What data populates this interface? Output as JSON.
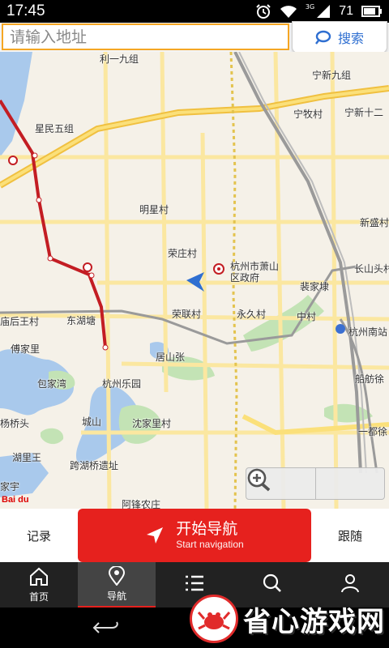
{
  "status_bar": {
    "time": "17:45",
    "network": "3G",
    "battery": "71"
  },
  "search": {
    "placeholder": "请输入地址",
    "button_label": "搜索"
  },
  "map": {
    "labels": [
      "利一九组",
      "宁新九组",
      "星民五组",
      "宁牧村",
      "宁新十二",
      "明星村",
      "新盛村",
      "荣庄村",
      "杭州市萧山区政府",
      "长山头村",
      "裴家埭",
      "庙后王村",
      "东湖塘",
      "荣联村",
      "永久村",
      "中村",
      "杭州南站",
      "傅家里",
      "居山张",
      "包家湾",
      "杭州乐园",
      "船舫徐",
      "杨桥头",
      "城山",
      "沈家里村",
      "一都徐",
      "湖里王",
      "跨湖桥遗址",
      "阿锋农庄",
      "家宇"
    ],
    "logo_text": "Bai du"
  },
  "nav_row": {
    "record_label": "记录",
    "start_label": "开始导航",
    "start_sub_label": "Start navigation",
    "follow_label": "跟随"
  },
  "tabs": [
    {
      "label": "首页",
      "icon": "home-icon"
    },
    {
      "label": "导航",
      "icon": "location-pin-icon"
    },
    {
      "label": "",
      "icon": "list-icon"
    },
    {
      "label": "",
      "icon": "search-icon"
    },
    {
      "label": "",
      "icon": "user-icon"
    }
  ],
  "watermark": {
    "text": "省心游戏网"
  },
  "colors": {
    "accent_red": "#e6211e",
    "search_blue": "#2f6fd1",
    "search_border": "#f5a623",
    "tab_bg": "#222222"
  }
}
